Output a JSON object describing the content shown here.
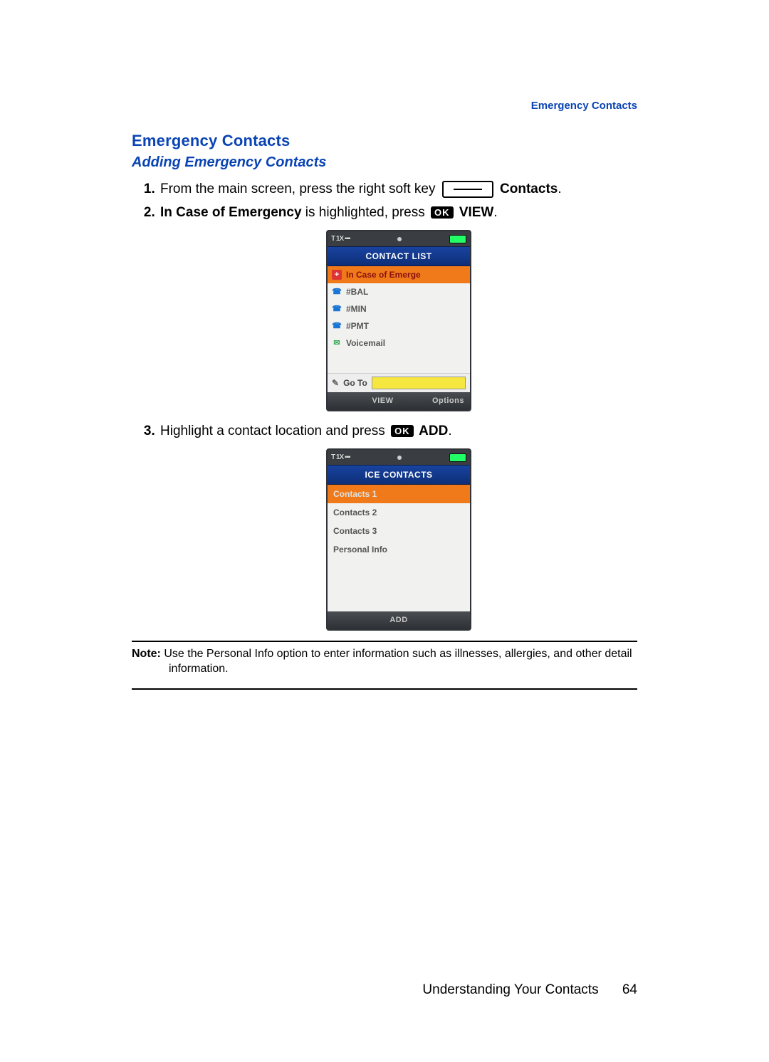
{
  "runningHeader": "Emergency Contacts",
  "heading1": "Emergency Contacts",
  "heading2": "Adding Emergency Contacts",
  "steps": {
    "s1": {
      "text_a": "From the main screen, press the right soft key ",
      "text_b": " Contacts",
      "text_c": "."
    },
    "s2": {
      "bold_a": "In Case of Emergency",
      "text_a": " is highlighted, press ",
      "ok": "OK",
      "bold_b": " VIEW",
      "text_b": "."
    },
    "s3": {
      "text_a": "Highlight a contact location and press ",
      "ok": "OK",
      "bold_a": " ADD",
      "text_b": "."
    }
  },
  "phone1": {
    "status_left": "T 1X ▪▪▪",
    "title": "CONTACT LIST",
    "rows": {
      "r0": "In Case of Emerge",
      "r1": "#BAL",
      "r2": "#MIN",
      "r3": "#PMT",
      "r4": "Voicemail"
    },
    "goto": "Go To",
    "soft_center": "VIEW",
    "soft_right": "Options"
  },
  "phone2": {
    "status_left": "T 1X ▪▪▪",
    "title": "ICE CONTACTS",
    "rows": {
      "r0": "Contacts 1",
      "r1": "Contacts 2",
      "r2": "Contacts 3",
      "r3": "Personal Info"
    },
    "soft_center": "ADD"
  },
  "note": {
    "label": "Note:",
    "body_a": " Use the Personal Info option to enter information such as illnesses, allergies, and other detail",
    "body_b": "information."
  },
  "footer": {
    "section": "Understanding Your Contacts",
    "page": "64"
  }
}
